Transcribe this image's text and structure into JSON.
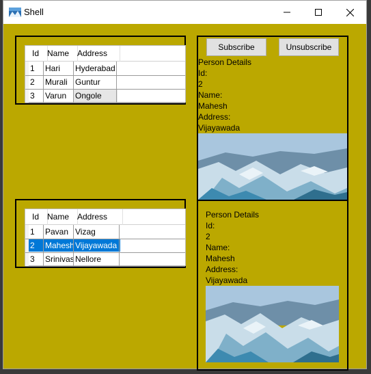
{
  "window": {
    "title": "Shell",
    "icon": "landscape-app-icon"
  },
  "controls": {
    "minimize": "minimize-icon",
    "maximize": "maximize-icon",
    "close": "close-icon"
  },
  "colors": {
    "client_bg": "#bba800",
    "selection": "#0078d7"
  },
  "grid1": {
    "columns": [
      "Id",
      "Name",
      "Address"
    ],
    "rows": [
      {
        "id": "1",
        "name": "Hari",
        "address": "Hyderabad"
      },
      {
        "id": "2",
        "name": "Murali",
        "address": "Guntur"
      },
      {
        "id": "3",
        "name": "Varun",
        "address": "Ongole"
      }
    ]
  },
  "grid2": {
    "columns": [
      "Id",
      "Name",
      "Address"
    ],
    "rows": [
      {
        "id": "1",
        "name": "Pavan",
        "address": "Vizag"
      },
      {
        "id": "2",
        "name": "Mahesh",
        "address": "Vijayawada"
      },
      {
        "id": "3",
        "name": "Srinivas",
        "address": "Nellore"
      }
    ],
    "selected_row": 1
  },
  "buttons": {
    "subscribe": "Subscribe",
    "unsubscribe": "Unsubscribe"
  },
  "details_top": {
    "heading": "Person Details",
    "id_label": "Id:",
    "id": "2",
    "name_label": "Name:",
    "name": "Mahesh",
    "address_label": "Address:",
    "address": "Vijayawada",
    "image": "glacier-photo"
  },
  "details_bottom": {
    "heading": "Person Details",
    "id_label": "Id:",
    "id": "2",
    "name_label": "Name:",
    "name": "Mahesh",
    "address_label": "Address:",
    "address": "Vijayawada",
    "image": "glacier-photo"
  }
}
